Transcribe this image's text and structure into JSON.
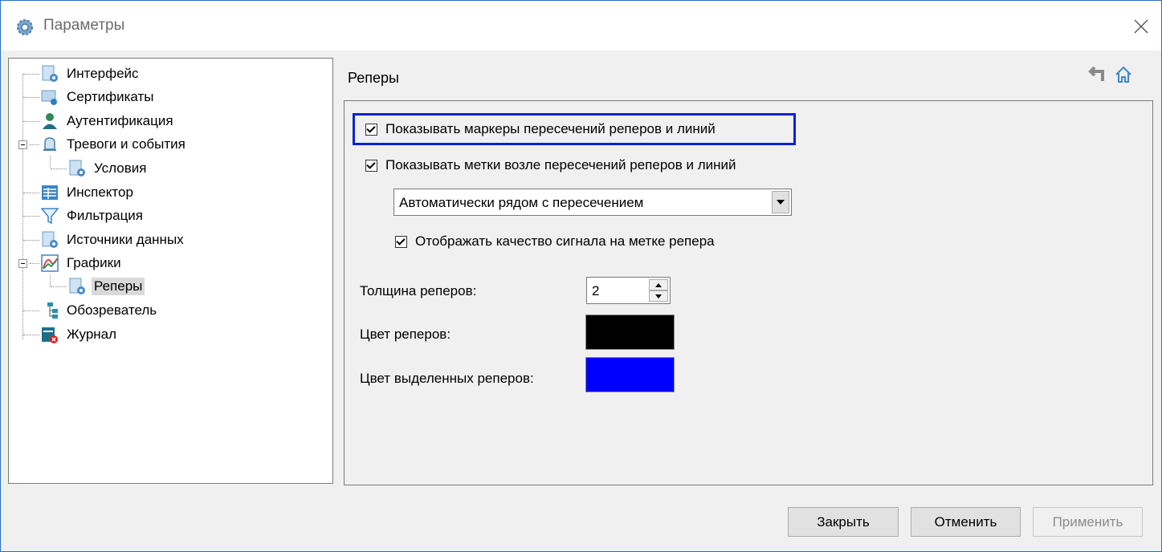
{
  "window": {
    "title": "Параметры"
  },
  "tree": {
    "items": [
      {
        "label": "Интерфейс",
        "icon": "interface-settings-icon"
      },
      {
        "label": "Сертификаты",
        "icon": "certificate-icon"
      },
      {
        "label": "Аутентификация",
        "icon": "user-icon"
      },
      {
        "label": "Тревоги и события",
        "icon": "bell-icon"
      },
      {
        "label": "Условия",
        "icon": "conditions-icon"
      },
      {
        "label": "Инспектор",
        "icon": "grid-icon"
      },
      {
        "label": "Фильтрация",
        "icon": "filter-icon"
      },
      {
        "label": "Источники данных",
        "icon": "data-sources-icon"
      },
      {
        "label": "Графики",
        "icon": "chart-icon"
      },
      {
        "label": "Реперы",
        "icon": "markers-icon"
      },
      {
        "label": "Обозреватель",
        "icon": "tree-view-icon"
      },
      {
        "label": "Журнал",
        "icon": "journal-icon"
      }
    ],
    "selected": "Реперы"
  },
  "section": {
    "title": "Реперы"
  },
  "options": {
    "show_markers": {
      "label": "Показывать маркеры пересечений реперов и линий",
      "checked": true
    },
    "show_labels": {
      "label": "Показывать метки возле пересечений реперов и линий",
      "checked": true
    },
    "label_position": {
      "value": "Автоматически рядом с пересечением"
    },
    "show_quality": {
      "label": "Отображать качество сигнала на метке репера",
      "checked": true
    },
    "thickness": {
      "label": "Толщина реперов:",
      "value": "2"
    },
    "color": {
      "label": "Цвет реперов:",
      "value": "#000000"
    },
    "selected_color": {
      "label": "Цвет выделенных реперов:",
      "value": "#0000ff"
    }
  },
  "buttons": {
    "close": "Закрыть",
    "cancel": "Отменить",
    "apply": "Применить"
  }
}
